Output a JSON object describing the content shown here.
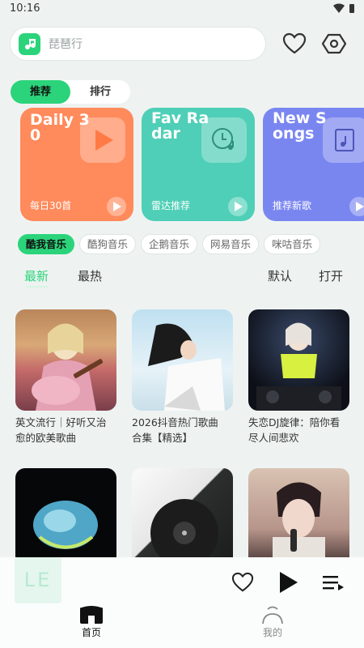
{
  "status": {
    "time": "10:16"
  },
  "search": {
    "placeholder": "琵琶行",
    "logo_icon": "music-note-icon"
  },
  "header": {
    "favorite_icon": "heart-icon",
    "settings_icon": "hexagon-settings-icon"
  },
  "tabs": [
    {
      "label": "推荐",
      "active": true
    },
    {
      "label": "排行",
      "active": false
    }
  ],
  "cards": [
    {
      "title": "Daily 30",
      "label": "每日30首",
      "color": "#ff8a5b",
      "icon": "play-icon"
    },
    {
      "title": "Fav Radar",
      "label": "雷达推荐",
      "color": "#4fcfb7",
      "icon": "clock-music-icon"
    },
    {
      "title": "New Songs",
      "label": "推荐新歌",
      "color": "#7a86f0",
      "icon": "music-document-icon"
    }
  ],
  "sources": [
    {
      "label": "酷我音乐",
      "active": true
    },
    {
      "label": "酷狗音乐",
      "active": false
    },
    {
      "label": "企鹅音乐",
      "active": false
    },
    {
      "label": "网易音乐",
      "active": false
    },
    {
      "label": "咪咕音乐",
      "active": false
    }
  ],
  "filters": {
    "latest": "最新",
    "hot": "最热",
    "default": "默认",
    "open": "打开"
  },
  "playlists": [
    {
      "title": "英文流行｜好听又治愈的欧美歌曲"
    },
    {
      "title": "2026抖音热门歌曲合集【精选】"
    },
    {
      "title": "失恋DJ旋律：陪你看尽人间悲欢"
    },
    {
      "title": ""
    },
    {
      "title": ""
    },
    {
      "title": ""
    }
  ],
  "player": {
    "cover_text": "LE"
  },
  "nav": [
    {
      "label": "首页",
      "active": true
    },
    {
      "label": "我的",
      "active": false
    }
  ],
  "colors": {
    "accent": "#2bd47a",
    "background": "#eef3f2"
  }
}
